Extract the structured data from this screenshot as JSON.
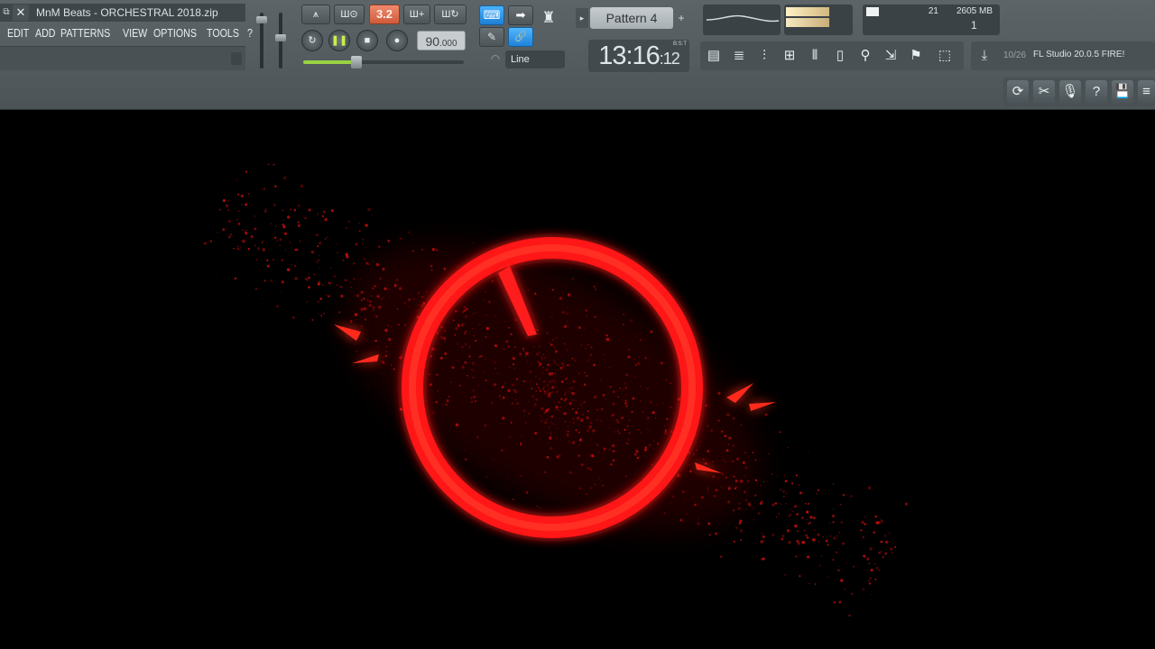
{
  "window": {
    "title": "MnM Beats - ORCHESTRAL 2018.zip",
    "restore_glyph": "⧉",
    "close_glyph": "✕"
  },
  "menu": [
    "EDIT",
    "ADD",
    "PATTERNS",
    "VIEW",
    "OPTIONS",
    "TOOLS",
    "?"
  ],
  "transport": {
    "pattern_song_glyph": "⩚",
    "tempo_tap_label": "3.2",
    "snap_glyphs": [
      "Ш⊙",
      "Ш+",
      "Ш↻"
    ],
    "loop_glyph": "↻",
    "play_glyph": "❚❚",
    "stop_glyph": "■",
    "record_glyph": "●",
    "tempo_whole": "90",
    "tempo_fraction": ".000",
    "master_pitch_fraction": 0.33
  },
  "snap": {
    "typing_keyboard_glyph": "⌨",
    "step_arrow_glyph": "➡",
    "metronome_glyph": "♜",
    "brush_glyph": "✎",
    "link_glyph": "🔗",
    "headphone_glyph": "◠",
    "mode": "Line"
  },
  "pattern": {
    "prev_glyph": "▸",
    "name": "Pattern 4",
    "add_glyph": "+"
  },
  "time": {
    "main": "13:16",
    "sub": "12",
    "unit": "B:S:T"
  },
  "monitors": {
    "voices": "21",
    "memory": "2605 MB",
    "polyphony": "1"
  },
  "windows": [
    "▤",
    "≣",
    "⫶",
    "⊞",
    "⫴",
    "▯",
    "⚲",
    "⇲",
    "⚑",
    "⬚"
  ],
  "news": {
    "icon_glyph": "⤓",
    "count": "10/26",
    "text": "FL Studio 20.0.5 FIRE!"
  },
  "right_tools": [
    "⟳",
    "✂",
    "🎙",
    "?",
    "💾",
    "≡"
  ],
  "colors": {
    "ring": "#ff1414",
    "accent_green": "#9bd243",
    "tempo_tap": "#e4714f",
    "link_blue": "#2a8fe0"
  }
}
